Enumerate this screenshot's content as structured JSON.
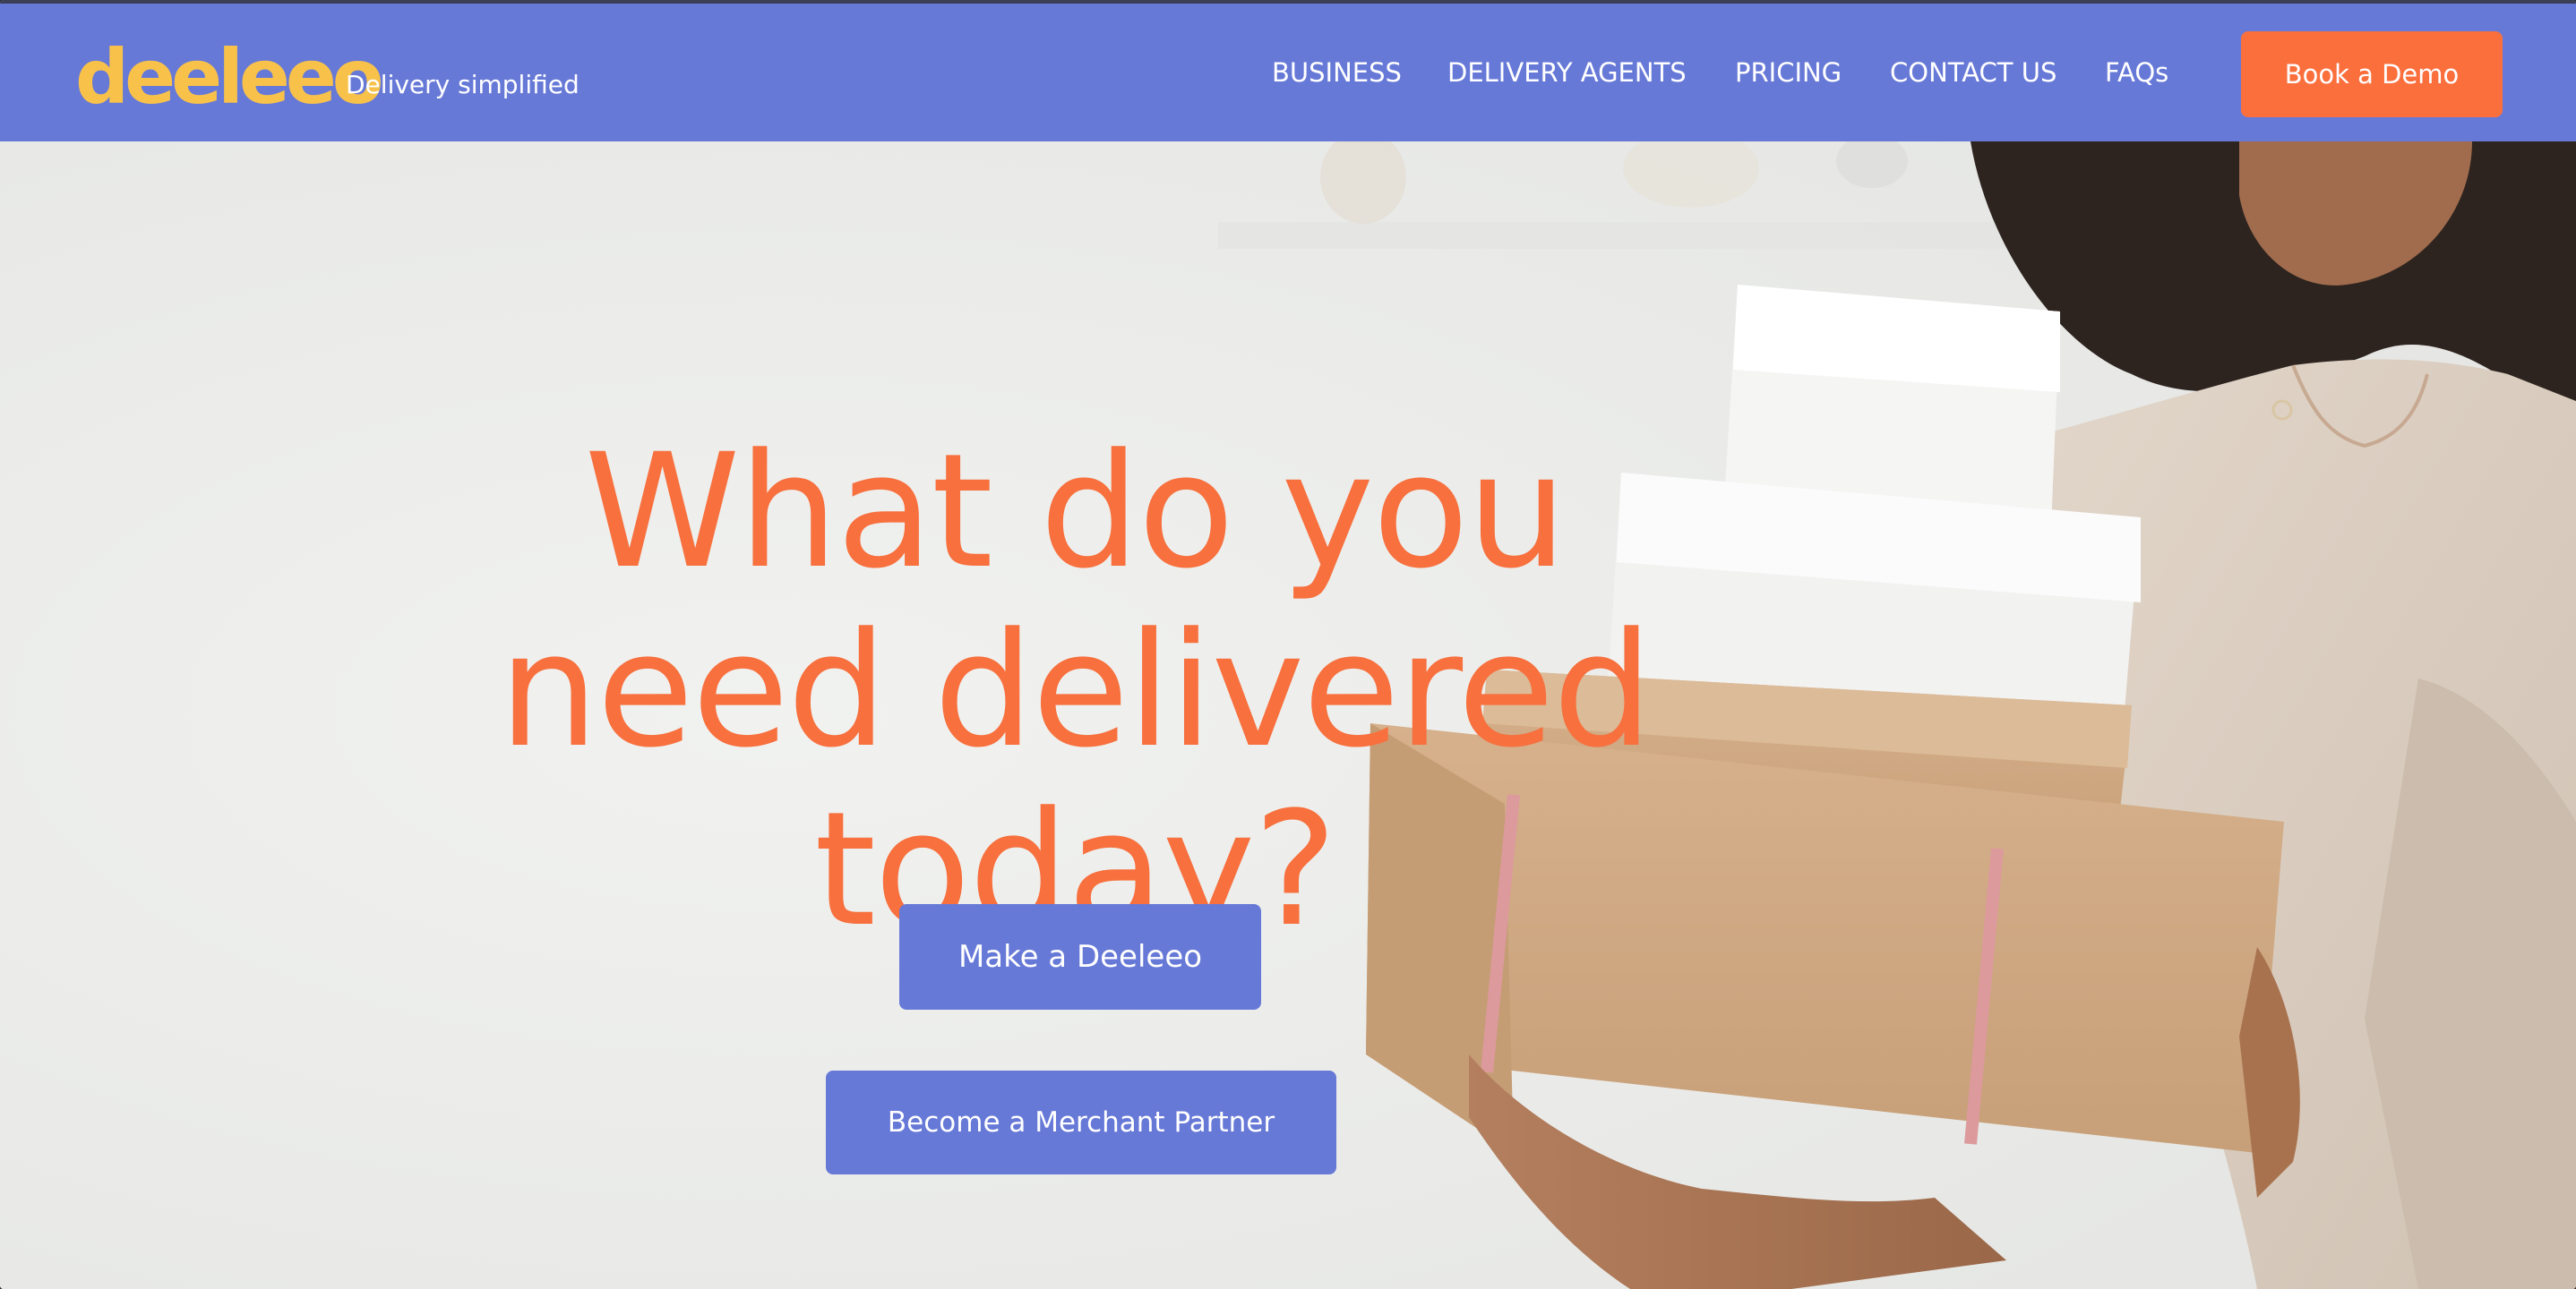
{
  "header": {
    "logo": "deeleeo",
    "tagline": "Delivery simplified",
    "nav": [
      {
        "label": "BUSINESS"
      },
      {
        "label": "DELIVERY AGENTS"
      },
      {
        "label": "PRICING"
      },
      {
        "label": "CONTACT US"
      },
      {
        "label": "FAQs"
      }
    ],
    "cta_label": "Book a Demo"
  },
  "hero": {
    "headline": [
      "What do you",
      "need delivered",
      "today?"
    ],
    "primary_button": "Make a Deeleeo",
    "secondary_button": "Become a Merchant Partner"
  },
  "colors": {
    "header_bg": "#6779d7",
    "logo": "#f8c24a",
    "accent_orange": "#fb6f3d",
    "headline": "#f7703e",
    "button_bg": "#6779d7"
  }
}
